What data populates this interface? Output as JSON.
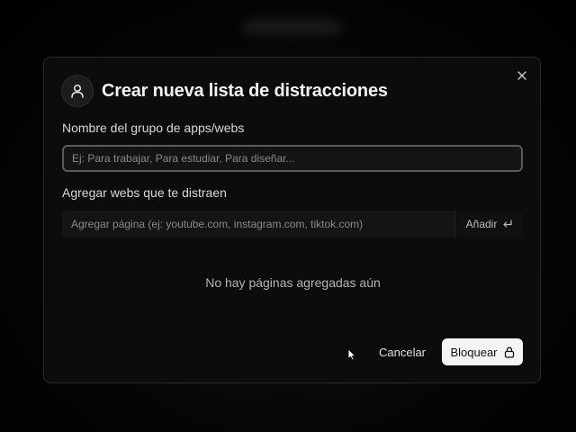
{
  "modal": {
    "title": "Crear nueva lista de distracciones",
    "avatar_icon": "user-icon",
    "close_icon": "close-icon"
  },
  "group_field": {
    "label": "Nombre del grupo de apps/webs",
    "value": "",
    "placeholder": "Ej: Para trabajar, Para estudiar, Para diseñar..."
  },
  "web_field": {
    "label": "Agregar webs que te distraen",
    "value": "",
    "placeholder": "Agregar página (ej: youtube.com, instagram.com, tiktok.com)",
    "add_label": "Añadir",
    "add_icon": "enter-icon"
  },
  "empty_state": "No hay páginas agregadas aún",
  "actions": {
    "cancel_label": "Cancelar",
    "block_label": "Bloquear",
    "block_icon": "lock-icon"
  },
  "colors": {
    "background": "#000000",
    "modal": "#0c0c0c",
    "primary_button": "#f4f4f4"
  }
}
